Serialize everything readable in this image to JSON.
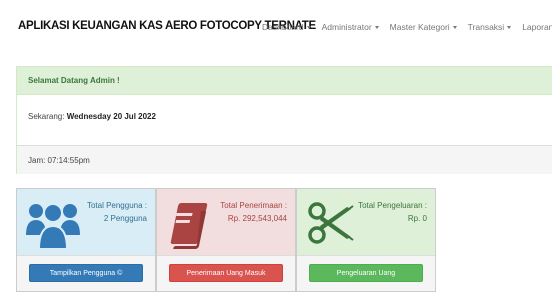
{
  "app": {
    "title": "APLIKASI KEUANGAN KAS AERO FOTOCOPY TERNATE"
  },
  "nav": {
    "items": [
      {
        "label": "Dashboard"
      },
      {
        "label": "Administrator"
      },
      {
        "label": "Master Kategori"
      },
      {
        "label": "Transaksi"
      },
      {
        "label": "Laporan"
      }
    ]
  },
  "welcome": {
    "heading": "Selamat Datang Admin !",
    "now_label": "Sekarang:",
    "date": "Wednesday 20 Jul 2022",
    "time": "Jam: 07:14:55pm"
  },
  "cards": {
    "users": {
      "label": "Total Pengguna :",
      "value": "2 Pengguna",
      "button": "Tampilkan Pengguna ©",
      "icon": "users-icon"
    },
    "income": {
      "label": "Total Penerimaan :",
      "value": "Rp. 292,543,044",
      "button": "Penerimaan Uang Masuk",
      "icon": "book-icon"
    },
    "expense": {
      "label": "Total Pengeluaran :",
      "value": "Rp. 0",
      "button": "Pengeluaran Uang",
      "icon": "scissors-icon"
    }
  },
  "colors": {
    "primary": "#337ab7",
    "danger": "#d9534f",
    "success": "#5cb85c",
    "info_bg": "#d9edf7",
    "danger_bg": "#f2dede",
    "success_bg": "#dff0d8"
  }
}
